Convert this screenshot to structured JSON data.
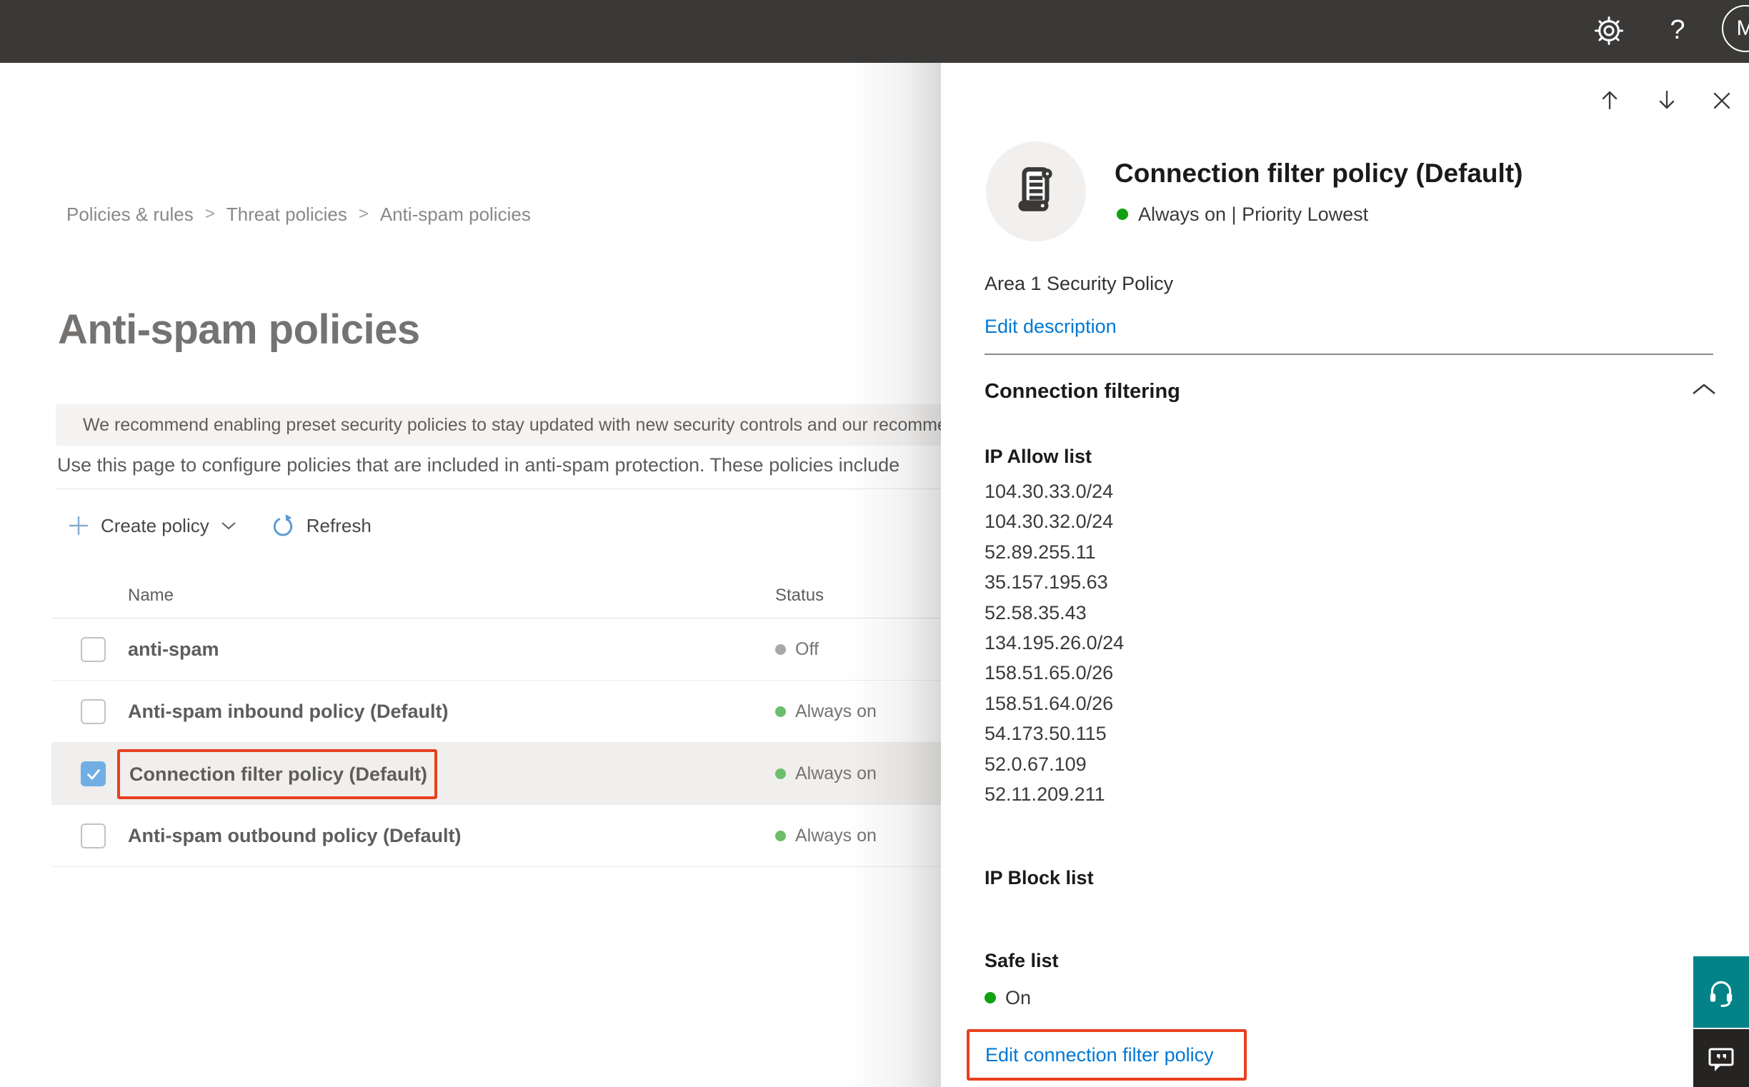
{
  "topbar": {
    "help_label": "?",
    "avatar_initial": "M"
  },
  "breadcrumb": {
    "items": [
      "Policies & rules",
      "Threat policies",
      "Anti-spam policies"
    ]
  },
  "page": {
    "title": "Anti-spam policies",
    "banner_text": "We recommend enabling preset security policies to stay updated with new security controls and our recomme",
    "description": "Use this page to configure policies that are included in anti-spam protection. These policies include"
  },
  "toolbar": {
    "create_label": "Create policy",
    "refresh_label": "Refresh"
  },
  "table": {
    "columns": [
      "Name",
      "Status"
    ],
    "rows": [
      {
        "name": "anti-spam",
        "status": "Off",
        "state": "off",
        "checked": false,
        "selected": false
      },
      {
        "name": "Anti-spam inbound policy (Default)",
        "status": "Always on",
        "state": "on",
        "checked": false,
        "selected": false
      },
      {
        "name": "Connection filter policy (Default)",
        "status": "Always on",
        "state": "on",
        "checked": true,
        "selected": true
      },
      {
        "name": "Anti-spam outbound policy (Default)",
        "status": "Always on",
        "state": "on",
        "checked": false,
        "selected": false
      }
    ]
  },
  "flyout": {
    "title": "Connection filter policy (Default)",
    "status_line": "Always on | Priority Lowest",
    "description": "Area 1 Security Policy",
    "edit_description_label": "Edit description",
    "section_title": "Connection filtering",
    "ip_allow_label": "IP Allow list",
    "ip_allow_list": [
      "104.30.33.0/24",
      "104.30.32.0/24",
      "52.89.255.11",
      "35.157.195.63",
      "52.58.35.43",
      "134.195.26.0/24",
      "158.51.65.0/26",
      "158.51.64.0/26",
      "54.173.50.115",
      "52.0.67.109",
      "52.11.209.211"
    ],
    "ip_block_label": "IP Block list",
    "safe_list_label": "Safe list",
    "safe_list_status": "On",
    "edit_link_label": "Edit connection filter policy"
  },
  "colors": {
    "accent_blue": "#0078d4",
    "highlight_red": "#e8401f",
    "status_green_bright": "#11a00e",
    "status_green_soft": "#6cbe6c",
    "status_gray": "#a8a8a8",
    "checkbox_blue": "#71aee3",
    "teal_button": "#038387"
  }
}
